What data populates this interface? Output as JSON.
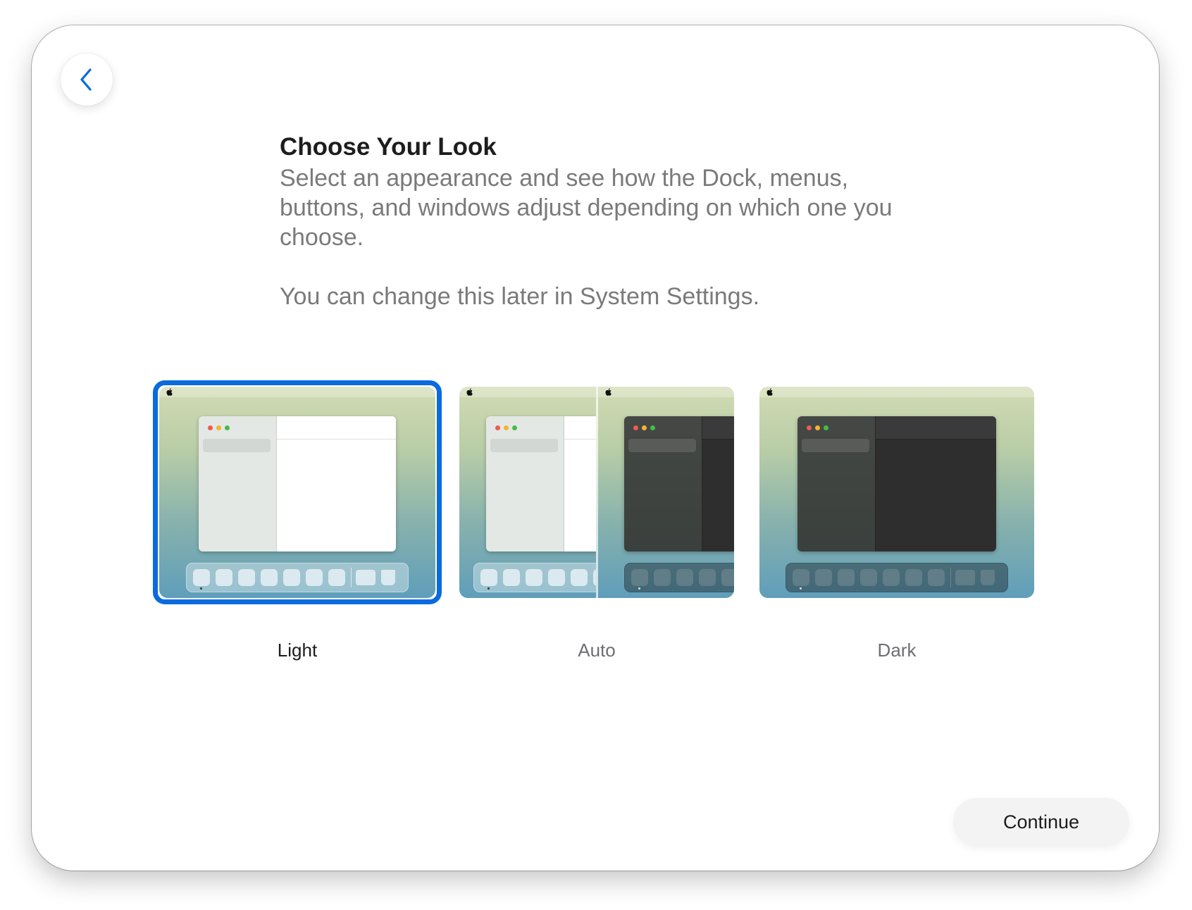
{
  "header": {
    "title": "Choose Your Look",
    "subtitle": "Select an appearance and see how the Dock, menus, buttons, and windows adjust depending on which one you choose.",
    "note": "You can change this later in System Settings."
  },
  "appearance_options": [
    {
      "label": "Light",
      "selected": true
    },
    {
      "label": "Auto",
      "selected": false
    },
    {
      "label": "Dark",
      "selected": false
    }
  ],
  "footer": {
    "continue_label": "Continue"
  },
  "icons": {
    "back": "chevron-left-icon",
    "apple": "apple-logo-icon"
  },
  "colors": {
    "accent": "#0a6bde",
    "selected_label": "#1d1d1f",
    "unselected_label": "#6e6e73"
  }
}
